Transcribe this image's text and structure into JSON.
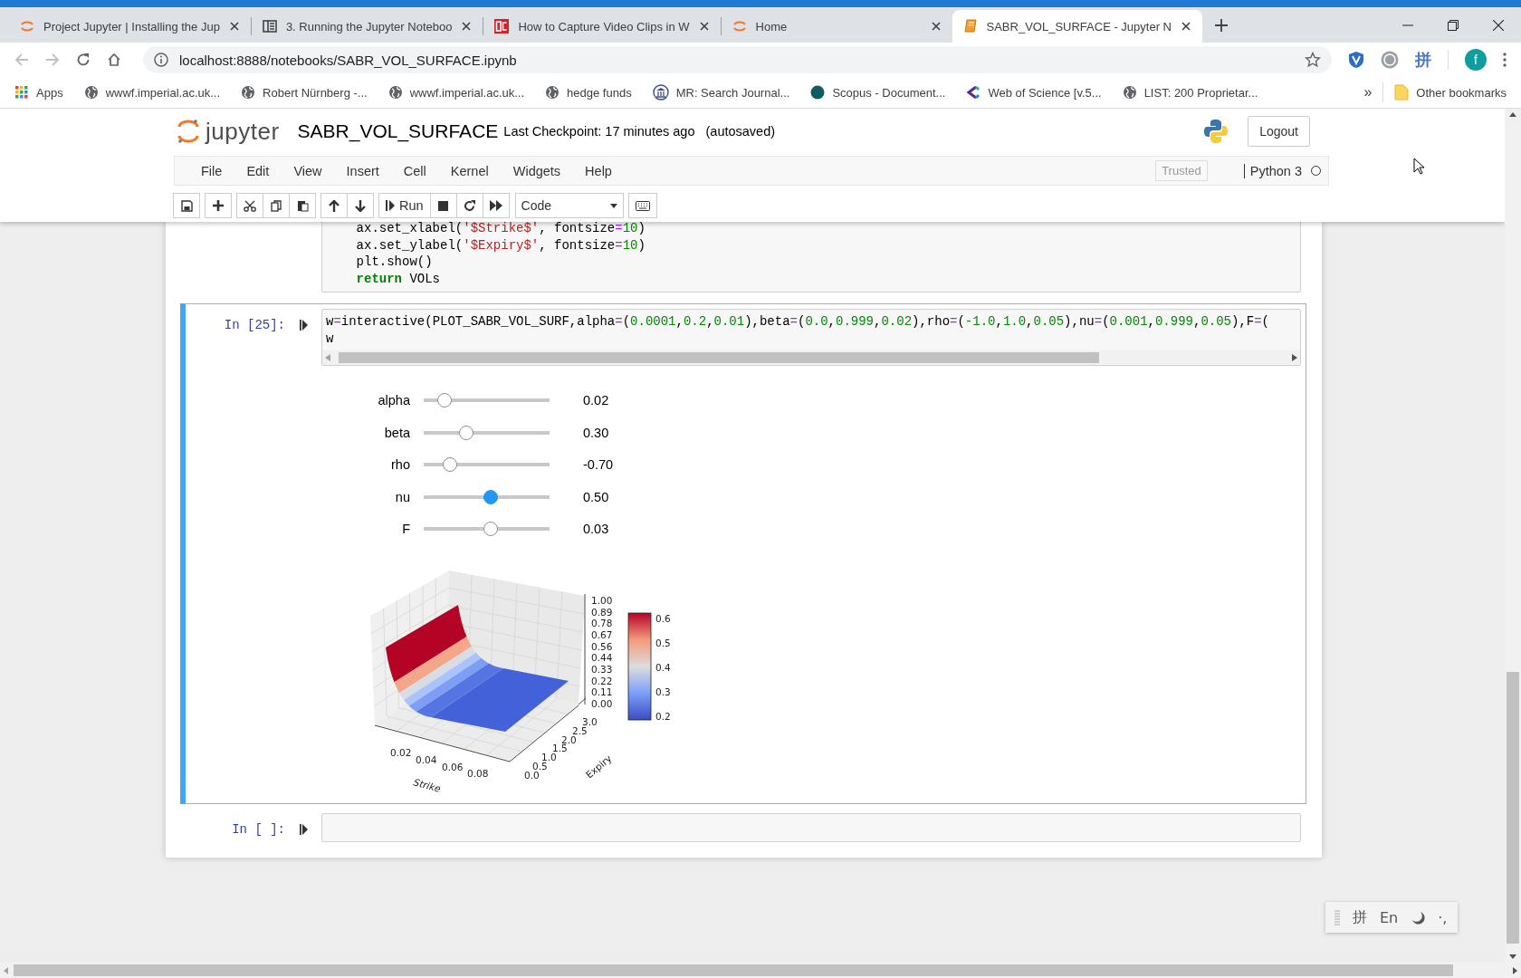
{
  "browser": {
    "tabs": [
      {
        "title": "Project Jupyter | Installing the Jup",
        "kind": "jupyter",
        "selected": false
      },
      {
        "title": "3. Running the Jupyter Noteboo",
        "kind": "book",
        "selected": false
      },
      {
        "title": "How to Capture Video Clips in W",
        "kind": "pc",
        "selected": false
      },
      {
        "title": "Home",
        "kind": "jupyter",
        "selected": false
      },
      {
        "title": "SABR_VOL_SURFACE - Jupyter N",
        "kind": "notebook",
        "selected": true
      }
    ],
    "address": "localhost:8888/notebooks/SABR_VOL_SURFACE.ipynb",
    "extension_glyph": "拼",
    "profile_initial": "f",
    "bookmarks": [
      {
        "label": "Apps",
        "kind": "apps"
      },
      {
        "label": "wwwf.imperial.ac.uk...",
        "kind": "globe"
      },
      {
        "label": "Robert Nürnberg -...",
        "kind": "globe"
      },
      {
        "label": "wwwf.imperial.ac.uk...",
        "kind": "globe"
      },
      {
        "label": "hedge funds",
        "kind": "globe"
      },
      {
        "label": "MR: Search Journal...",
        "kind": "bank"
      },
      {
        "label": "Scopus - Document...",
        "kind": "dot"
      },
      {
        "label": "Web of Science [v.5...",
        "kind": "chevron"
      },
      {
        "label": "LIST: 200 Proprietar...",
        "kind": "globe"
      }
    ],
    "more": "»",
    "other_bookmarks": "Other bookmarks"
  },
  "jupyter": {
    "logo_text": "jupyter",
    "notebook_name": "SABR_VOL_SURFACE",
    "checkpoint": "Last Checkpoint: 17 minutes ago",
    "autosave": "(autosaved)",
    "logout": "Logout",
    "menu": [
      "File",
      "Edit",
      "View",
      "Insert",
      "Cell",
      "Kernel",
      "Widgets",
      "Help"
    ],
    "trusted": "Trusted",
    "kernel_name": "Python 3",
    "kernel_busy": false,
    "run_label": "Run",
    "cell_type": "Code"
  },
  "cells": [
    {
      "selected": false,
      "lines": [
        [
          {
            "text": "    ax.set_xlabel(",
            "kind": "plain"
          },
          {
            "text": "'$Strike$'",
            "kind": "string"
          },
          {
            "text": ", fontsize",
            "kind": "plain"
          },
          {
            "text": "=",
            "kind": "operator"
          },
          {
            "text": "10",
            "kind": "number"
          },
          {
            "text": ")",
            "kind": "plain"
          }
        ],
        [
          {
            "text": "    ax.set_ylabel(",
            "kind": "plain"
          },
          {
            "text": "'$Expiry$'",
            "kind": "string"
          },
          {
            "text": ", fontsize",
            "kind": "plain"
          },
          {
            "text": "=",
            "kind": "operator"
          },
          {
            "text": "10",
            "kind": "number"
          },
          {
            "text": ")",
            "kind": "plain"
          }
        ],
        [
          {
            "text": "    plt.show()",
            "kind": "plain"
          }
        ],
        [
          {
            "text": "    return",
            "kind": "keyword"
          },
          {
            "text": " VOLs",
            "kind": "plain"
          }
        ]
      ]
    },
    {
      "prompt": "In [25]:",
      "selected": true,
      "lines": [
        [
          {
            "text": "w",
            "kind": "plain"
          },
          {
            "text": "=",
            "kind": "operator"
          },
          {
            "text": "interactive(PLOT_SABR_VOL_SURF,alpha",
            "kind": "plain"
          },
          {
            "text": "=",
            "kind": "operator"
          },
          {
            "text": "(",
            "kind": "plain"
          },
          {
            "text": "0.0001",
            "kind": "number"
          },
          {
            "text": ",",
            "kind": "plain"
          },
          {
            "text": "0.2",
            "kind": "number"
          },
          {
            "text": ",",
            "kind": "plain"
          },
          {
            "text": "0.01",
            "kind": "number"
          },
          {
            "text": "),beta",
            "kind": "plain"
          },
          {
            "text": "=",
            "kind": "operator"
          },
          {
            "text": "(",
            "kind": "plain"
          },
          {
            "text": "0.0",
            "kind": "number"
          },
          {
            "text": ",",
            "kind": "plain"
          },
          {
            "text": "0.999",
            "kind": "number"
          },
          {
            "text": ",",
            "kind": "plain"
          },
          {
            "text": "0.02",
            "kind": "number"
          },
          {
            "text": "),rho",
            "kind": "plain"
          },
          {
            "text": "=",
            "kind": "operator"
          },
          {
            "text": "(",
            "kind": "plain"
          },
          {
            "text": "-1.0",
            "kind": "number"
          },
          {
            "text": ",",
            "kind": "plain"
          },
          {
            "text": "1.0",
            "kind": "number"
          },
          {
            "text": ",",
            "kind": "plain"
          },
          {
            "text": "0.05",
            "kind": "number"
          },
          {
            "text": "),nu",
            "kind": "plain"
          },
          {
            "text": "=",
            "kind": "operator"
          },
          {
            "text": "(",
            "kind": "plain"
          },
          {
            "text": "0.001",
            "kind": "number"
          },
          {
            "text": ",",
            "kind": "plain"
          },
          {
            "text": "0.999",
            "kind": "number"
          },
          {
            "text": ",",
            "kind": "plain"
          },
          {
            "text": "0.05",
            "kind": "number"
          },
          {
            "text": "),F",
            "kind": "plain"
          },
          {
            "text": "=",
            "kind": "operator"
          },
          {
            "text": "(",
            "kind": "plain"
          }
        ],
        [
          {
            "text": "w",
            "kind": "plain"
          }
        ]
      ],
      "sliders": [
        {
          "label": "alpha",
          "level": 0.12,
          "reading": "0.02",
          "focused": false
        },
        {
          "label": "beta",
          "level": 0.32,
          "reading": "0.30",
          "focused": false
        },
        {
          "label": "rho",
          "level": 0.17,
          "reading": "-0.70",
          "focused": false
        },
        {
          "label": "nu",
          "level": 0.54,
          "reading": "0.50",
          "focused": true
        },
        {
          "label": "F",
          "level": 0.54,
          "reading": "0.03",
          "focused": false
        }
      ],
      "plot": {
        "kind": "surface3d",
        "xlabel": "Strike",
        "ylabel": "Expiry",
        "xticks": [
          "0.02",
          "0.04",
          "0.06",
          "0.08"
        ],
        "yticks": [
          "0.0",
          "0.5",
          "1.0",
          "1.5",
          "2.0",
          "2.5",
          "3.0"
        ],
        "zticks": [
          "1.00",
          "0.89",
          "0.78",
          "0.67",
          "0.56",
          "0.44",
          "0.33",
          "0.22",
          "0.11",
          "0.00"
        ],
        "colorbar_ticks": [
          "0.6",
          "0.5",
          "0.4",
          "0.3",
          "0.2"
        ]
      }
    },
    {
      "prompt": "In [ ]:",
      "selected": false
    }
  ],
  "ime": {
    "mode": "拼",
    "language": "En",
    "punctuation": "·,"
  }
}
